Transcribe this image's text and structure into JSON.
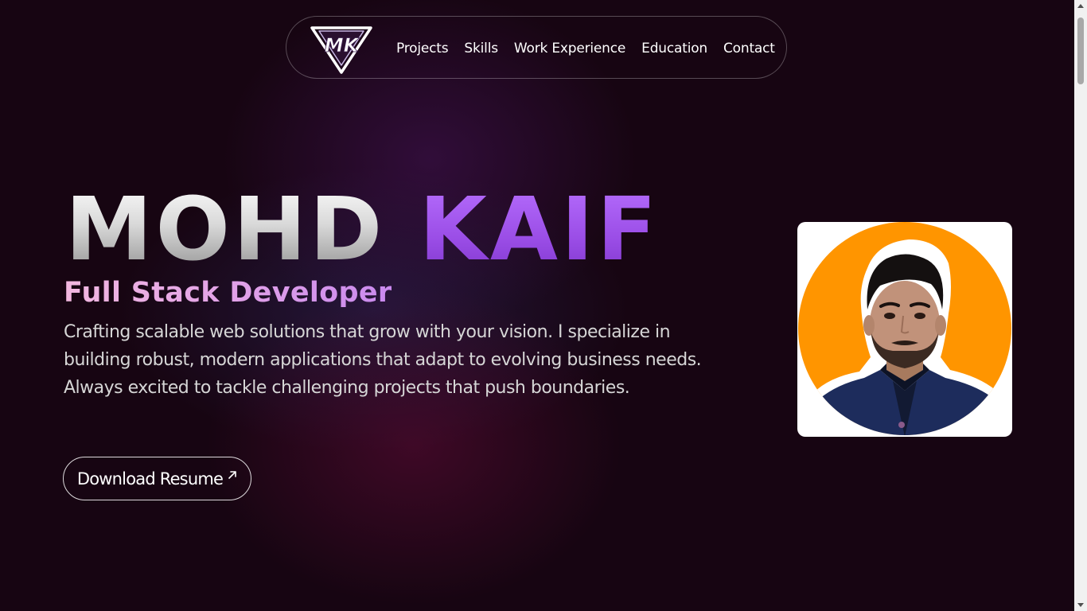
{
  "nav": {
    "logo_text": "MK",
    "links": [
      {
        "label": "Projects"
      },
      {
        "label": "Skills"
      },
      {
        "label": "Work Experience"
      },
      {
        "label": "Education"
      },
      {
        "label": "Contact"
      }
    ]
  },
  "hero": {
    "first_name": "MOHD",
    "last_name": "KAIF",
    "role": "Full Stack Developer",
    "bio": "Crafting scalable web solutions that grow with your vision. I specialize in building robust, modern applications that adapt to evolving business needs. Always excited to tackle challenging projects that push boundaries.",
    "resume_button": "Download Resume",
    "resume_icon": "arrow-up-right-icon"
  },
  "profile": {
    "photo_icon": "profile-photo"
  },
  "colors": {
    "background": "#170512",
    "accent_purple": "#9a4de6",
    "role_pink": "#e0a0e8",
    "photo_orange": "#ff9500"
  }
}
